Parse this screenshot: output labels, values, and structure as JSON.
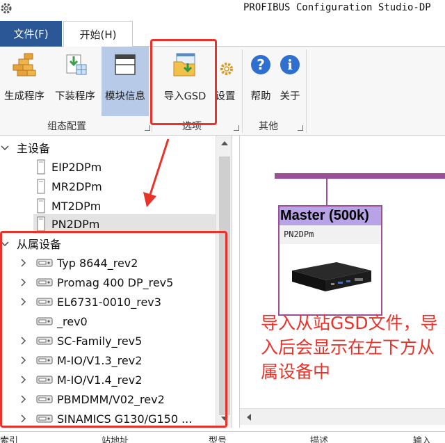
{
  "window": {
    "title": "PROFIBUS Configuration Studio-DP"
  },
  "tabs": {
    "file": "文件(F)",
    "home": "开始(H)"
  },
  "ribbon": {
    "groups": [
      {
        "label": "组态配置",
        "buttons": [
          "生成程序",
          "下装程序",
          "模块信息"
        ]
      },
      {
        "label": "选项",
        "buttons": [
          "导入GSD",
          "设置"
        ]
      },
      {
        "label": "其他",
        "buttons": [
          "帮助",
          "关于"
        ]
      }
    ],
    "active_button": "模块信息"
  },
  "tree": {
    "master_group": "主设备",
    "masters": [
      "EIP2DPm",
      "MR2DPm",
      "MT2DPm",
      "PN2DPm"
    ],
    "selected_master": "PN2DPm",
    "slave_group": "从属设备",
    "slaves": [
      {
        "label": "Typ 8644_rev2",
        "expandable": true
      },
      {
        "label": "Promag 400 DP_rev5",
        "expandable": true
      },
      {
        "label": "EL6731-0010_rev3",
        "expandable": true
      },
      {
        "label": "_rev0",
        "expandable": false
      },
      {
        "label": "SC-Family_rev5",
        "expandable": true
      },
      {
        "label": "M-IO/V1.3_rev2",
        "expandable": true
      },
      {
        "label": "M-IO/V1.4_rev2",
        "expandable": true
      },
      {
        "label": "PBMDMM/V02_rev2",
        "expandable": true
      },
      {
        "label": "SINAMICS G130/G150 ...",
        "expandable": true
      }
    ]
  },
  "canvas": {
    "master_title": "Master (500k)",
    "master_device": "PN2DPm",
    "annotation": "导入从站GSD文件，导入后会显示在左下方从属设备中"
  },
  "bottom_columns": [
    "索引",
    "站地址",
    "型号",
    "描述",
    "输入"
  ],
  "colors": {
    "accent": "#2b5797",
    "bus": "#9b4f96",
    "master_header": "#b8a3e6",
    "highlight": "#e8332a"
  }
}
